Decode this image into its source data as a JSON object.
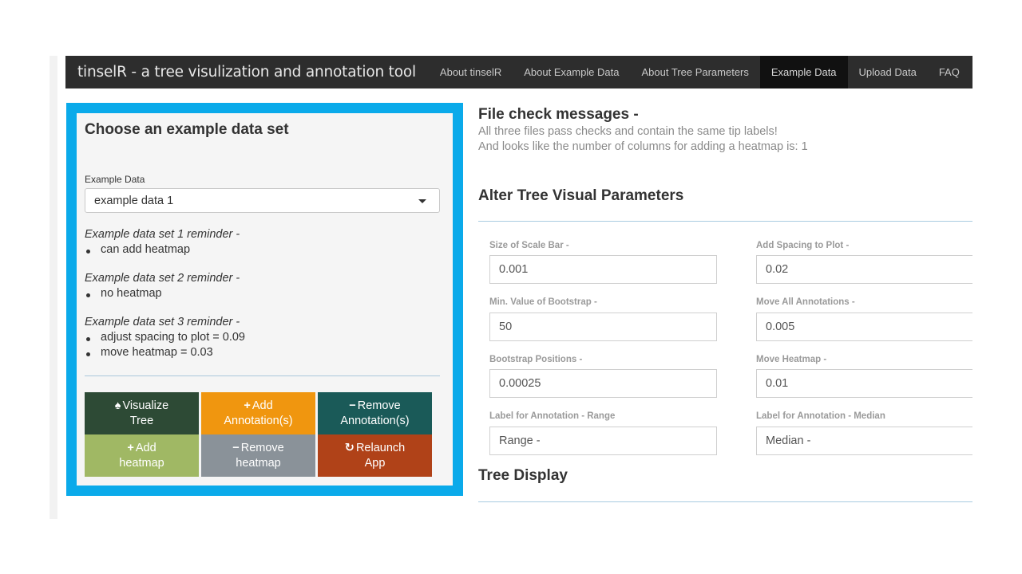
{
  "navbar": {
    "brand": "tinselR - a tree visulization and annotation tool",
    "items": [
      {
        "label": "About tinselR",
        "active": false
      },
      {
        "label": "About Example Data",
        "active": false
      },
      {
        "label": "About Tree Parameters",
        "active": false
      },
      {
        "label": "Example Data",
        "active": true
      },
      {
        "label": "Upload Data",
        "active": false
      },
      {
        "label": "FAQ",
        "active": false
      }
    ]
  },
  "sidebar": {
    "title": "Choose an example data set",
    "select_label": "Example Data",
    "select_value": "example data 1",
    "reminders": [
      {
        "head": "Example data set 1 reminder -",
        "bullets": [
          "can add heatmap"
        ]
      },
      {
        "head": "Example data set 2 reminder -",
        "bullets": [
          "no heatmap"
        ]
      },
      {
        "head": "Example data set 3 reminder -",
        "bullets": [
          "adjust spacing to plot = 0.09",
          "move heatmap = 0.03"
        ]
      }
    ],
    "buttons": [
      {
        "icon": "tree-icon",
        "glyph": "♠",
        "line1": "Visualize",
        "line2": "Tree",
        "color": "#2d4a35"
      },
      {
        "icon": "plus-icon",
        "glyph": "+",
        "line1": "Add",
        "line2": "Annotation(s)",
        "color": "#f0960f"
      },
      {
        "icon": "minus-icon",
        "glyph": "−",
        "line1": "Remove",
        "line2": "Annotation(s)",
        "color": "#1a5a58"
      },
      {
        "icon": "plus-icon",
        "glyph": "+",
        "line1": "Add",
        "line2": "heatmap",
        "color": "#a0b864"
      },
      {
        "icon": "minus-icon",
        "glyph": "−",
        "line1": "Remove",
        "line2": "heatmap",
        "color": "#8a9299"
      },
      {
        "icon": "refresh-icon",
        "glyph": "↻",
        "line1": "Relaunch",
        "line2": "App",
        "color": "#b04218"
      }
    ]
  },
  "main": {
    "file_check_title": "File check messages -",
    "file_check_msg1": "All three files pass checks and contain the same tip labels!",
    "file_check_msg2": "And looks like the number of columns for adding a heatmap is:  1",
    "params_title": "Alter Tree Visual Parameters",
    "params": [
      {
        "label": "Size of Scale Bar -",
        "value": "0.001"
      },
      {
        "label": "Add Spacing to Plot -",
        "value": "0.02"
      },
      {
        "label": "Min. Value of Bootstrap -",
        "value": "50"
      },
      {
        "label": "Move All Annotations -",
        "value": "0.005"
      },
      {
        "label": "Bootstrap Positions -",
        "value": "0.00025"
      },
      {
        "label": "Move Heatmap -",
        "value": "0.01"
      },
      {
        "label": "Label for Annotation - Range",
        "value": "Range -"
      },
      {
        "label": "Label for Annotation - Median",
        "value": "Median -"
      }
    ],
    "tree_display_title": "Tree Display"
  },
  "colors": {
    "navbar_bg": "#2d2d2d",
    "navbar_active_bg": "#111111",
    "panel_highlight": "#0aaaea"
  }
}
